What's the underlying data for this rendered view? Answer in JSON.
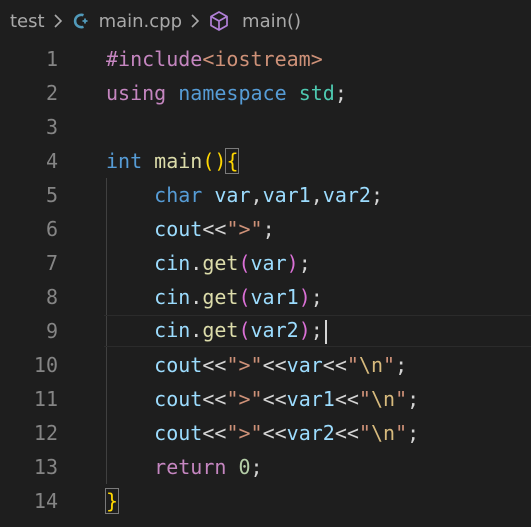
{
  "breadcrumb": {
    "folder": "test",
    "file": "main.cpp",
    "symbol": "main()"
  },
  "colors": {
    "background": "#1e1e1e",
    "keyword": "#569cd6",
    "control": "#c586c0",
    "function": "#dcdcaa",
    "variable": "#9cdcfe",
    "type": "#4ec9b0",
    "string": "#ce9178",
    "number": "#b5cea8",
    "line_number": "#858585",
    "bracket_level1": "#ffd700",
    "bracket_level2": "#da70d6",
    "cpp_icon": "#519aba",
    "symbol_icon": "#b180d7"
  },
  "editor": {
    "current_line": 9,
    "lines": [
      {
        "n": "1",
        "tokens": [
          [
            "#include",
            "ctrl"
          ],
          [
            "<iostream>",
            "str"
          ]
        ]
      },
      {
        "n": "2",
        "tokens": [
          [
            "using",
            "ctrl"
          ],
          [
            " ",
            "punct"
          ],
          [
            "namespace",
            "kw"
          ],
          [
            " ",
            "punct"
          ],
          [
            "std",
            "type"
          ],
          [
            ";",
            "punct"
          ]
        ]
      },
      {
        "n": "3",
        "tokens": []
      },
      {
        "n": "4",
        "tokens": [
          [
            "int",
            "kw"
          ],
          [
            " ",
            "punct"
          ],
          [
            "main",
            "fn"
          ],
          [
            "()",
            "brk1"
          ],
          [
            "{",
            "brk1"
          ]
        ]
      },
      {
        "n": "5",
        "tokens": [
          [
            "    ",
            "punct"
          ],
          [
            "char",
            "kw"
          ],
          [
            " ",
            "punct"
          ],
          [
            "var",
            "var"
          ],
          [
            ",",
            "punct"
          ],
          [
            "var1",
            "var"
          ],
          [
            ",",
            "punct"
          ],
          [
            "var2",
            "var"
          ],
          [
            ";",
            "punct"
          ]
        ]
      },
      {
        "n": "6",
        "tokens": [
          [
            "    ",
            "punct"
          ],
          [
            "cout",
            "var"
          ],
          [
            "<<",
            "punct"
          ],
          [
            "\">\"",
            "str"
          ],
          [
            ";",
            "punct"
          ]
        ]
      },
      {
        "n": "7",
        "tokens": [
          [
            "    ",
            "punct"
          ],
          [
            "cin",
            "var"
          ],
          [
            ".",
            "punct"
          ],
          [
            "get",
            "fn"
          ],
          [
            "(",
            "brk2"
          ],
          [
            "var",
            "var"
          ],
          [
            ")",
            "brk2"
          ],
          [
            ";",
            "punct"
          ]
        ]
      },
      {
        "n": "8",
        "tokens": [
          [
            "    ",
            "punct"
          ],
          [
            "cin",
            "var"
          ],
          [
            ".",
            "punct"
          ],
          [
            "get",
            "fn"
          ],
          [
            "(",
            "brk2"
          ],
          [
            "var1",
            "var"
          ],
          [
            ")",
            "brk2"
          ],
          [
            ";",
            "punct"
          ]
        ]
      },
      {
        "n": "9",
        "tokens": [
          [
            "    ",
            "punct"
          ],
          [
            "cin",
            "var"
          ],
          [
            ".",
            "punct"
          ],
          [
            "get",
            "fn"
          ],
          [
            "(",
            "brk2"
          ],
          [
            "var2",
            "var"
          ],
          [
            ")",
            "brk2"
          ],
          [
            ";",
            "punct"
          ]
        ]
      },
      {
        "n": "10",
        "tokens": [
          [
            "    ",
            "punct"
          ],
          [
            "cout",
            "var"
          ],
          [
            "<<",
            "punct"
          ],
          [
            "\">\"",
            "str"
          ],
          [
            "<<",
            "punct"
          ],
          [
            "var",
            "var"
          ],
          [
            "<<",
            "punct"
          ],
          [
            "\"",
            "str"
          ],
          [
            "\\n",
            "esc"
          ],
          [
            "\"",
            "str"
          ],
          [
            ";",
            "punct"
          ]
        ]
      },
      {
        "n": "11",
        "tokens": [
          [
            "    ",
            "punct"
          ],
          [
            "cout",
            "var"
          ],
          [
            "<<",
            "punct"
          ],
          [
            "\">\"",
            "str"
          ],
          [
            "<<",
            "punct"
          ],
          [
            "var1",
            "var"
          ],
          [
            "<<",
            "punct"
          ],
          [
            "\"",
            "str"
          ],
          [
            "\\n",
            "esc"
          ],
          [
            "\"",
            "str"
          ],
          [
            ";",
            "punct"
          ]
        ]
      },
      {
        "n": "12",
        "tokens": [
          [
            "    ",
            "punct"
          ],
          [
            "cout",
            "var"
          ],
          [
            "<<",
            "punct"
          ],
          [
            "\">\"",
            "str"
          ],
          [
            "<<",
            "punct"
          ],
          [
            "var2",
            "var"
          ],
          [
            "<<",
            "punct"
          ],
          [
            "\"",
            "str"
          ],
          [
            "\\n",
            "esc"
          ],
          [
            "\"",
            "str"
          ],
          [
            ";",
            "punct"
          ]
        ]
      },
      {
        "n": "13",
        "tokens": [
          [
            "    ",
            "punct"
          ],
          [
            "return",
            "ctrl"
          ],
          [
            " ",
            "punct"
          ],
          [
            "0",
            "num"
          ],
          [
            ";",
            "punct"
          ]
        ]
      },
      {
        "n": "14",
        "tokens": [
          [
            "}",
            "brk1"
          ]
        ]
      }
    ]
  }
}
